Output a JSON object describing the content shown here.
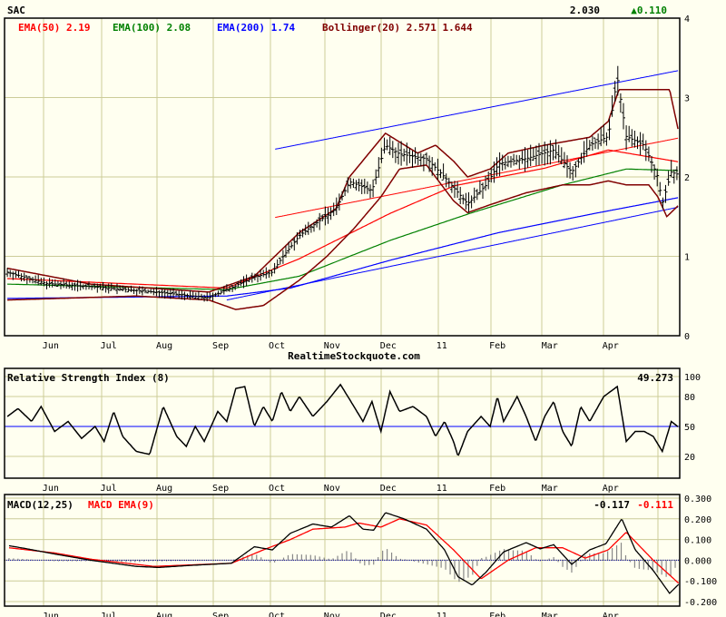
{
  "header": {
    "symbol": "SAC",
    "last": "2.030",
    "change": "▲0.110",
    "change_color": "#008000"
  },
  "watermark": "RealtimeStockquote.com",
  "legend": {
    "ema50": "EMA(50) 2.19",
    "ema100": "EMA(100) 2.08",
    "ema200": "EMA(200) 1.74",
    "bollinger": "Bollinger(20) 2.571 1.644"
  },
  "colors": {
    "ema50": "#ff0000",
    "ema100": "#008000",
    "ema200": "#0000ff",
    "bollinger": "#800000",
    "grid": "#cccc99",
    "bg": "#fffff0"
  },
  "rsi_panel": {
    "title": "Relative Strength Index (8)",
    "value": "49.273"
  },
  "macd_panel": {
    "title": "MACD(12,25)",
    "signal_title": "MACD EMA(9)",
    "macd_value": "-0.117",
    "signal_value": "-0.111"
  },
  "chart_data": [
    {
      "type": "line",
      "title": "SAC",
      "x_unit": "months from start of chart",
      "xlim": [
        0,
        12
      ],
      "ylim": [
        0,
        4
      ],
      "yticks": [
        "0",
        "1",
        "2",
        "3",
        "4"
      ],
      "month_labels": [
        {
          "label": "Jun",
          "t": 0.82
        },
        {
          "label": "Jul",
          "t": 1.85
        },
        {
          "label": "Aug",
          "t": 2.84
        },
        {
          "label": "Sep",
          "t": 3.84
        },
        {
          "label": "Oct",
          "t": 4.84
        },
        {
          "label": "Nov",
          "t": 5.82
        },
        {
          "label": "Dec",
          "t": 6.82
        },
        {
          "label": "11",
          "t": 7.77
        },
        {
          "label": "Feb",
          "t": 8.76
        },
        {
          "label": "Mar",
          "t": 9.69
        },
        {
          "label": "Apr",
          "t": 10.77
        }
      ],
      "price": [
        [
          0.05,
          0.8
        ],
        [
          0.73,
          0.66
        ],
        [
          1.85,
          0.6
        ],
        [
          2.82,
          0.54
        ],
        [
          3.63,
          0.48
        ],
        [
          4.11,
          0.63
        ],
        [
          4.44,
          0.74
        ],
        [
          4.76,
          0.8
        ],
        [
          4.92,
          0.97
        ],
        [
          5.24,
          1.26
        ],
        [
          5.56,
          1.43
        ],
        [
          5.89,
          1.6
        ],
        [
          6.13,
          1.94
        ],
        [
          6.53,
          1.83
        ],
        [
          6.77,
          2.4
        ],
        [
          7.02,
          2.29
        ],
        [
          7.5,
          2.23
        ],
        [
          7.82,
          2.0
        ],
        [
          8.23,
          1.66
        ],
        [
          8.55,
          1.89
        ],
        [
          8.79,
          2.17
        ],
        [
          9.27,
          2.23
        ],
        [
          9.76,
          2.34
        ],
        [
          10.08,
          2.06
        ],
        [
          10.4,
          2.4
        ],
        [
          10.73,
          2.51
        ],
        [
          10.89,
          3.26
        ],
        [
          11.05,
          2.51
        ],
        [
          11.37,
          2.4
        ],
        [
          11.61,
          2.0
        ],
        [
          11.69,
          1.66
        ],
        [
          11.85,
          2.06
        ],
        [
          11.98,
          2.03
        ]
      ],
      "ema50": [
        [
          0.05,
          0.72
        ],
        [
          3.95,
          0.6
        ],
        [
          5.24,
          0.97
        ],
        [
          6.85,
          1.54
        ],
        [
          8.0,
          1.89
        ],
        [
          9.6,
          2.11
        ],
        [
          10.73,
          2.34
        ],
        [
          11.98,
          2.19
        ]
      ],
      "ema100": [
        [
          0.05,
          0.65
        ],
        [
          3.95,
          0.58
        ],
        [
          5.24,
          0.75
        ],
        [
          6.85,
          1.2
        ],
        [
          8.31,
          1.55
        ],
        [
          9.92,
          1.9
        ],
        [
          11.05,
          2.1
        ],
        [
          11.98,
          2.08
        ]
      ],
      "ema200": [
        [
          0.05,
          0.47
        ],
        [
          3.95,
          0.5
        ],
        [
          5.08,
          0.6
        ],
        [
          6.85,
          0.95
        ],
        [
          8.79,
          1.3
        ],
        [
          10.56,
          1.55
        ],
        [
          11.98,
          1.74
        ]
      ],
      "bollinger_upper": [
        [
          0.05,
          0.85
        ],
        [
          1.53,
          0.65
        ],
        [
          3.63,
          0.55
        ],
        [
          4.44,
          0.75
        ],
        [
          5.24,
          1.3
        ],
        [
          5.89,
          1.6
        ],
        [
          6.13,
          2.0
        ],
        [
          6.77,
          2.55
        ],
        [
          7.34,
          2.3
        ],
        [
          7.66,
          2.4
        ],
        [
          7.98,
          2.2
        ],
        [
          8.23,
          2.0
        ],
        [
          8.63,
          2.1
        ],
        [
          8.95,
          2.3
        ],
        [
          9.6,
          2.4
        ],
        [
          10.4,
          2.5
        ],
        [
          10.73,
          2.7
        ],
        [
          10.92,
          3.1
        ],
        [
          11.53,
          3.1
        ],
        [
          11.82,
          3.1
        ],
        [
          11.98,
          2.571
        ]
      ],
      "bollinger_lower": [
        [
          0.05,
          0.45
        ],
        [
          2.34,
          0.5
        ],
        [
          3.63,
          0.45
        ],
        [
          4.11,
          0.33
        ],
        [
          4.6,
          0.38
        ],
        [
          5.24,
          0.7
        ],
        [
          5.73,
          1.0
        ],
        [
          6.21,
          1.35
        ],
        [
          6.69,
          1.75
        ],
        [
          7.02,
          2.1
        ],
        [
          7.5,
          2.15
        ],
        [
          7.98,
          1.7
        ],
        [
          8.23,
          1.55
        ],
        [
          8.63,
          1.65
        ],
        [
          9.27,
          1.8
        ],
        [
          9.92,
          1.9
        ],
        [
          10.4,
          1.9
        ],
        [
          10.73,
          1.95
        ],
        [
          11.05,
          1.9
        ],
        [
          11.45,
          1.9
        ],
        [
          11.61,
          1.75
        ],
        [
          11.77,
          1.5
        ],
        [
          11.98,
          1.644
        ]
      ],
      "trend_upper": [
        [
          4.81,
          2.35
        ],
        [
          11.98,
          3.34
        ]
      ],
      "trend_middle": [
        [
          4.81,
          1.49
        ],
        [
          11.98,
          2.49
        ]
      ],
      "trend_lower": [
        [
          3.95,
          0.45
        ],
        [
          11.98,
          1.62
        ]
      ]
    },
    {
      "type": "line",
      "title": "Relative Strength Index (8)",
      "ylim": [
        0,
        100
      ],
      "yticks": [
        "20",
        "50",
        "80",
        "100"
      ],
      "reference_line": 50,
      "rsi": [
        [
          0.05,
          60
        ],
        [
          0.24,
          68
        ],
        [
          0.48,
          55
        ],
        [
          0.65,
          70
        ],
        [
          0.89,
          45
        ],
        [
          1.13,
          55
        ],
        [
          1.37,
          38
        ],
        [
          1.61,
          50
        ],
        [
          1.77,
          35
        ],
        [
          1.94,
          65
        ],
        [
          2.1,
          40
        ],
        [
          2.34,
          25
        ],
        [
          2.58,
          22
        ],
        [
          2.82,
          70
        ],
        [
          3.06,
          40
        ],
        [
          3.23,
          30
        ],
        [
          3.39,
          50
        ],
        [
          3.55,
          35
        ],
        [
          3.79,
          65
        ],
        [
          3.95,
          55
        ],
        [
          4.11,
          88
        ],
        [
          4.27,
          90
        ],
        [
          4.44,
          50
        ],
        [
          4.6,
          70
        ],
        [
          4.76,
          55
        ],
        [
          4.92,
          85
        ],
        [
          5.08,
          65
        ],
        [
          5.24,
          80
        ],
        [
          5.48,
          60
        ],
        [
          5.73,
          75
        ],
        [
          5.97,
          92
        ],
        [
          6.21,
          70
        ],
        [
          6.37,
          55
        ],
        [
          6.53,
          75
        ],
        [
          6.69,
          45
        ],
        [
          6.85,
          85
        ],
        [
          7.02,
          65
        ],
        [
          7.26,
          70
        ],
        [
          7.5,
          60
        ],
        [
          7.66,
          40
        ],
        [
          7.82,
          55
        ],
        [
          7.98,
          35
        ],
        [
          8.06,
          20
        ],
        [
          8.23,
          45
        ],
        [
          8.47,
          60
        ],
        [
          8.63,
          50
        ],
        [
          8.76,
          80
        ],
        [
          8.87,
          55
        ],
        [
          9.11,
          80
        ],
        [
          9.27,
          60
        ],
        [
          9.44,
          35
        ],
        [
          9.6,
          60
        ],
        [
          9.76,
          75
        ],
        [
          9.92,
          45
        ],
        [
          10.08,
          30
        ],
        [
          10.24,
          70
        ],
        [
          10.4,
          55
        ],
        [
          10.65,
          80
        ],
        [
          10.89,
          90
        ],
        [
          11.05,
          35
        ],
        [
          11.21,
          45
        ],
        [
          11.37,
          45
        ],
        [
          11.53,
          40
        ],
        [
          11.69,
          25
        ],
        [
          11.85,
          55
        ],
        [
          11.98,
          49.273
        ]
      ]
    },
    {
      "type": "line",
      "title": "MACD(12,25)",
      "ylim": [
        -0.2,
        0.3
      ],
      "yticks": [
        "0.300",
        "0.200",
        "0.100",
        "0.000",
        "-0.100",
        "-0.200"
      ],
      "macd": [
        [
          0.08,
          0.07
        ],
        [
          0.4,
          0.055
        ],
        [
          0.89,
          0.03
        ],
        [
          1.53,
          0.0
        ],
        [
          2.34,
          -0.03
        ],
        [
          2.74,
          -0.035
        ],
        [
          3.31,
          -0.025
        ],
        [
          4.03,
          -0.015
        ],
        [
          4.44,
          0.065
        ],
        [
          4.76,
          0.05
        ],
        [
          5.08,
          0.13
        ],
        [
          5.48,
          0.175
        ],
        [
          5.81,
          0.16
        ],
        [
          6.13,
          0.215
        ],
        [
          6.37,
          0.15
        ],
        [
          6.56,
          0.145
        ],
        [
          6.77,
          0.23
        ],
        [
          7.1,
          0.2
        ],
        [
          7.5,
          0.15
        ],
        [
          7.82,
          0.05
        ],
        [
          8.06,
          -0.08
        ],
        [
          8.31,
          -0.12
        ],
        [
          8.55,
          -0.06
        ],
        [
          8.87,
          0.04
        ],
        [
          9.27,
          0.085
        ],
        [
          9.52,
          0.055
        ],
        [
          9.76,
          0.075
        ],
        [
          10.08,
          -0.02
        ],
        [
          10.4,
          0.05
        ],
        [
          10.69,
          0.08
        ],
        [
          10.97,
          0.2
        ],
        [
          11.21,
          0.05
        ],
        [
          11.53,
          -0.05
        ],
        [
          11.82,
          -0.16
        ],
        [
          11.98,
          -0.117
        ]
      ],
      "signal": [
        [
          0.08,
          0.06
        ],
        [
          0.89,
          0.035
        ],
        [
          1.53,
          0.005
        ],
        [
          2.66,
          -0.03
        ],
        [
          4.03,
          -0.015
        ],
        [
          4.6,
          0.05
        ],
        [
          5.08,
          0.1
        ],
        [
          5.48,
          0.15
        ],
        [
          6.05,
          0.16
        ],
        [
          6.29,
          0.18
        ],
        [
          6.69,
          0.16
        ],
        [
          7.02,
          0.2
        ],
        [
          7.5,
          0.17
        ],
        [
          7.98,
          0.05
        ],
        [
          8.47,
          -0.09
        ],
        [
          8.95,
          0.0
        ],
        [
          9.44,
          0.06
        ],
        [
          9.92,
          0.06
        ],
        [
          10.32,
          0.01
        ],
        [
          10.73,
          0.05
        ],
        [
          11.05,
          0.135
        ],
        [
          11.53,
          0.0
        ],
        [
          11.98,
          -0.111
        ]
      ],
      "histogram": "macd minus signal"
    }
  ]
}
